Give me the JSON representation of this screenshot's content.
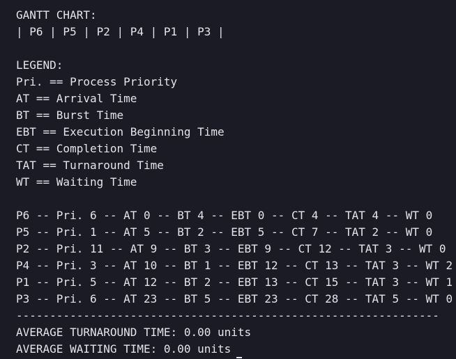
{
  "terminal": {
    "gantt_title": "GANTT CHART:",
    "gantt_sequence": "| P6 | P5 | P2 | P4 | P1 | P3 |",
    "legend_title": "LEGEND:",
    "legend": [
      "Pri. == Process Priority",
      "AT == Arrival Time",
      "BT == Burst Time",
      "EBT == Execution Beginning Time",
      "CT == Completion Time",
      "TAT == Turnaround Time",
      "WT == Waiting Time"
    ],
    "process_rows": [
      "P6 -- Pri. 6 -- AT 0 -- BT 4 -- EBT 0 -- CT 4 -- TAT 4 -- WT 0",
      "P5 -- Pri. 1 -- AT 5 -- BT 2 -- EBT 5 -- CT 7 -- TAT 2 -- WT 0",
      "P2 -- Pri. 11 -- AT 9 -- BT 3 -- EBT 9 -- CT 12 -- TAT 3 -- WT 0",
      "P4 -- Pri. 3 -- AT 10 -- BT 1 -- EBT 12 -- CT 13 -- TAT 3 -- WT 2",
      "P1 -- Pri. 5 -- AT 12 -- BT 2 -- EBT 13 -- CT 15 -- TAT 3 -- WT 1",
      "P3 -- Pri. 6 -- AT 23 -- BT 5 -- EBT 23 -- CT 28 -- TAT 5 -- WT 0"
    ],
    "separator": "---------------------------------------------------------------",
    "avg_turnaround": "AVERAGE TURNAROUND TIME: 0.00 units",
    "avg_waiting": "AVERAGE WAITING TIME: 0.00 units"
  },
  "colors": {
    "background": "#1b1b25",
    "foreground": "#e4e4ea"
  }
}
